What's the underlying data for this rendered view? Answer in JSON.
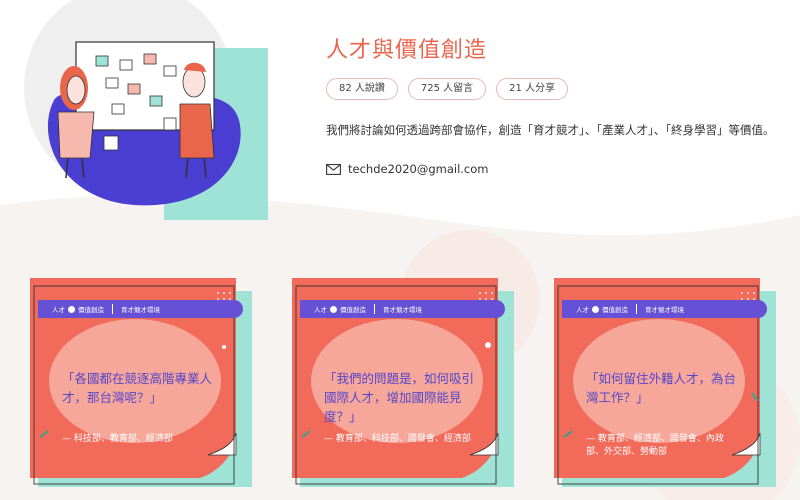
{
  "hero": {
    "title": "人才與價值創造",
    "stats": [
      "82 人說讚",
      "725 人留言",
      "21 人分享"
    ],
    "description": "我們將討論如何透過跨部會協作，創造「育才競才」、「產業人才」、「終身學習」等價值。",
    "email": "techde2020@gmail.com",
    "illustration_icon": "people-whiteboard-illustration"
  },
  "colors": {
    "accent": "#e9664d",
    "card_bg": "#f26a5a",
    "banner": "#6650d6",
    "teal": "#9fe3d6",
    "quote_text": "#5446c9"
  },
  "card_common": {
    "brand_left": "人才",
    "brand_right": "價值創造",
    "banner_tag": "育才競才環境"
  },
  "cards": [
    {
      "quote": "「各國都在競逐高階專業人才，那台灣呢？」",
      "departments": "— 科技部、教育部、經濟部"
    },
    {
      "quote": "「我們的問題是，如何吸引國際人才，增加國際能見度？」",
      "departments": "— 教育部、科技部、國發會、經濟部"
    },
    {
      "quote": "「如何留住外籍人才，為台灣工作？」",
      "departments": "— 教育部、經濟部、國發會、內政部、外交部、勞動部"
    }
  ]
}
